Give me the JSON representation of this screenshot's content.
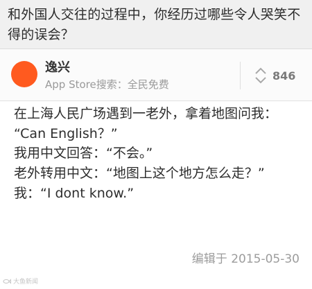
{
  "question": {
    "lines": [
      "和外国人交往的过程中，你经历过哪些令人哭笑不",
      "得的误会？"
    ]
  },
  "author": {
    "name": "逸兴",
    "bio": "App Store搜索：全民免费",
    "avatar_color": "#ff5a1f"
  },
  "vote": {
    "icon": "vote-arrows-icon",
    "count": "846"
  },
  "answer": {
    "lines": [
      "在上海人民广场遇到一老外，拿着地图问我：",
      "“Can English？”",
      "我用中文回答：“不会。”",
      "老外转用中文：“地图上这个地方怎么走？”",
      "我：“I dont know.”"
    ],
    "edited": "编辑于 2015-05-30"
  },
  "watermark": {
    "text": "大鱼新闻"
  }
}
